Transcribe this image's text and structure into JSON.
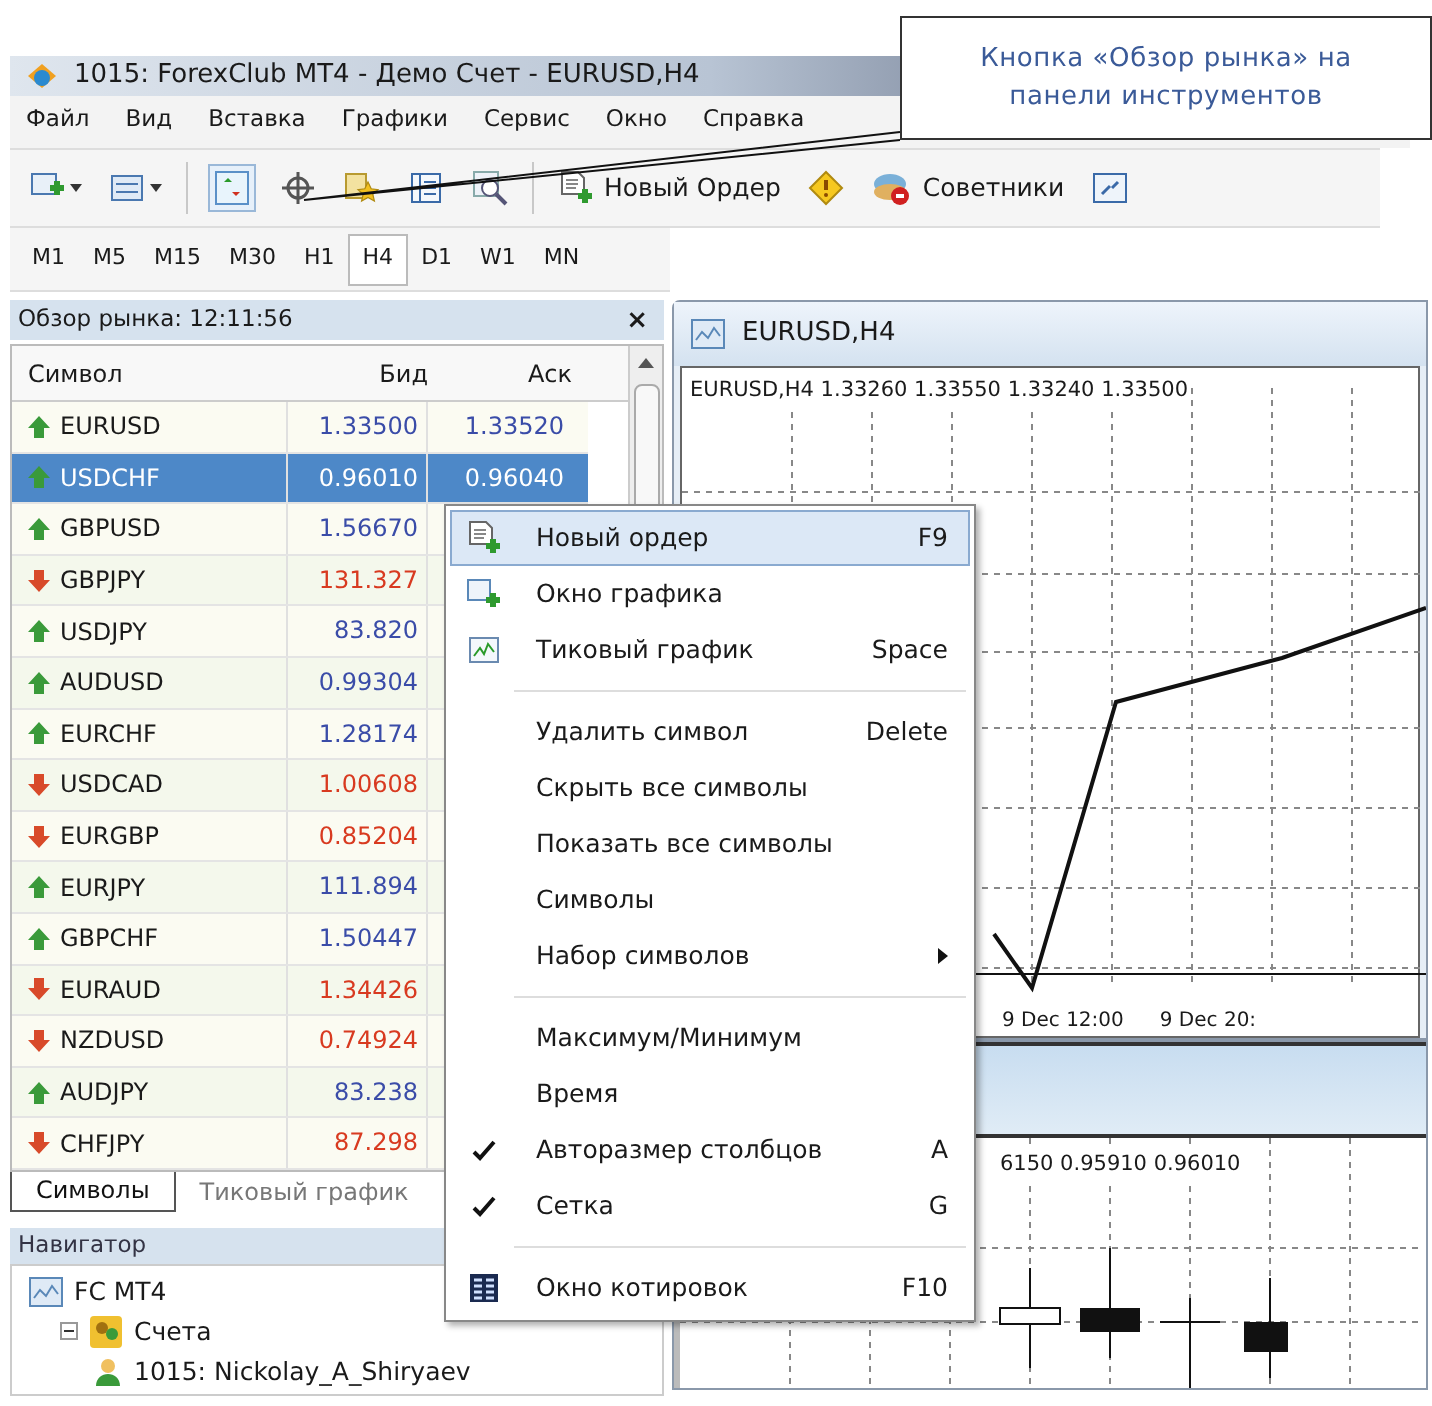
{
  "window": {
    "title": "1015: ForexClub MT4 - Демо Счет - EURUSD,H4"
  },
  "menu_bar": [
    "Файл",
    "Вид",
    "Вставка",
    "Графики",
    "Сервис",
    "Окно",
    "Справка"
  ],
  "toolbar": {
    "new_order": "Новый Ордер",
    "experts": "Советники"
  },
  "timeframes": [
    {
      "label": "M1",
      "selected": false
    },
    {
      "label": "M5",
      "selected": false
    },
    {
      "label": "M15",
      "selected": false
    },
    {
      "label": "M30",
      "selected": false
    },
    {
      "label": "H1",
      "selected": false
    },
    {
      "label": "H4",
      "selected": true
    },
    {
      "label": "D1",
      "selected": false
    },
    {
      "label": "W1",
      "selected": false
    },
    {
      "label": "MN",
      "selected": false
    }
  ],
  "market_watch": {
    "title": "Обзор рынка: 12:11:56",
    "close": "×",
    "columns": [
      "Символ",
      "Бид",
      "Аск"
    ],
    "rows": [
      {
        "symbol": "EURUSD",
        "bid": "1.33500",
        "ask": "1.33520",
        "rising": true,
        "selected": false
      },
      {
        "symbol": "USDCHF",
        "bid": "0.96010",
        "ask": "0.96040",
        "rising": true,
        "selected": true
      },
      {
        "symbol": "GBPUSD",
        "bid": "1.56670",
        "rising": true,
        "selected": false
      },
      {
        "symbol": "GBPJPY",
        "bid": "131.327",
        "rising": false,
        "selected": false
      },
      {
        "symbol": "USDJPY",
        "bid": "83.820",
        "rising": true,
        "selected": false
      },
      {
        "symbol": "AUDUSD",
        "bid": "0.99304",
        "rising": true,
        "selected": false
      },
      {
        "symbol": "EURCHF",
        "bid": "1.28174",
        "rising": true,
        "selected": false
      },
      {
        "symbol": "USDCAD",
        "bid": "1.00608",
        "rising": false,
        "selected": false
      },
      {
        "symbol": "EURGBP",
        "bid": "0.85204",
        "rising": false,
        "selected": false
      },
      {
        "symbol": "EURJPY",
        "bid": "111.894",
        "rising": true,
        "selected": false
      },
      {
        "symbol": "GBPCHF",
        "bid": "1.50447",
        "rising": true,
        "selected": false
      },
      {
        "symbol": "EURAUD",
        "bid": "1.34426",
        "rising": false,
        "selected": false
      },
      {
        "symbol": "NZDUSD",
        "bid": "0.74924",
        "rising": false,
        "selected": false
      },
      {
        "symbol": "AUDJPY",
        "bid": "83.238",
        "rising": true,
        "selected": false
      },
      {
        "symbol": "CHFJPY",
        "bid": "87.298",
        "rising": false,
        "selected": false
      }
    ],
    "tabs": [
      {
        "label": "Символы",
        "selected": true
      },
      {
        "label": "Тиковый график",
        "selected": false
      }
    ]
  },
  "navigator": {
    "title": "Навигатор",
    "tree": [
      {
        "label": "FC MT4",
        "children": [
          {
            "label": "Счета",
            "expanded": true,
            "children": [
              {
                "label": "1015: Nickolay_A_Shiryaev"
              }
            ]
          }
        ]
      }
    ]
  },
  "chart_window": {
    "title": "EURUSD,H4",
    "info": "EURUSD,H4  1.33260 1.33550 1.33240 1.33500",
    "time_labels": [
      "9 Dec 12:00",
      "9 Dec 20:"
    ]
  },
  "chart_window_2": {
    "info": "6150 0.95910 0.96010"
  },
  "context_menu": [
    {
      "kind": "item",
      "label": "Новый ордер",
      "shortcut": "F9",
      "selected": true
    },
    {
      "kind": "item",
      "label": "Окно графика",
      "selected": false
    },
    {
      "kind": "item",
      "label": "Тиковый график",
      "shortcut": "Space",
      "selected": false
    },
    {
      "kind": "separator"
    },
    {
      "kind": "item",
      "label": "Удалить символ",
      "shortcut": "Delete",
      "selected": false
    },
    {
      "kind": "item",
      "label": "Скрыть все символы",
      "selected": false
    },
    {
      "kind": "item",
      "label": "Показать все символы",
      "selected": false
    },
    {
      "kind": "item",
      "label": "Символы",
      "selected": false
    },
    {
      "kind": "item",
      "label": "Набор символов",
      "submenu": true,
      "selected": false
    },
    {
      "kind": "separator"
    },
    {
      "kind": "item",
      "label": "Максимум/Минимум",
      "selected": false
    },
    {
      "kind": "item",
      "label": "Время",
      "selected": false
    },
    {
      "kind": "item",
      "label": "Авторазмер столбцов",
      "shortcut": "A",
      "checked": true,
      "selected": false
    },
    {
      "kind": "item",
      "label": "Сетка",
      "shortcut": "G",
      "checked": true,
      "selected": false
    },
    {
      "kind": "separator"
    },
    {
      "kind": "item",
      "label": "Окно котировок",
      "shortcut": "F10",
      "selected": false
    }
  ],
  "callout": {
    "lines": [
      "Кнопка «Обзор рынка» на",
      "панели инструментов"
    ]
  }
}
